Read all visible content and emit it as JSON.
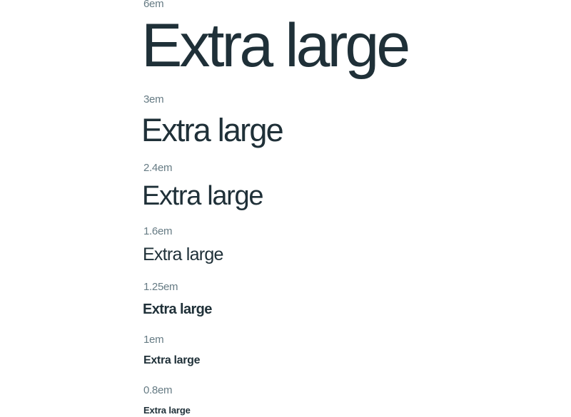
{
  "scale": [
    {
      "size_label": "6em",
      "sample_text": "Extra large"
    },
    {
      "size_label": "3em",
      "sample_text": "Extra large"
    },
    {
      "size_label": "2.4em",
      "sample_text": "Extra large"
    },
    {
      "size_label": "1.6em",
      "sample_text": "Extra large"
    },
    {
      "size_label": "1.25em",
      "sample_text": "Extra large"
    },
    {
      "size_label": "1em",
      "sample_text": "Extra large"
    },
    {
      "size_label": "0.8em",
      "sample_text": "Extra large"
    }
  ],
  "colors": {
    "label": "#667b84",
    "sample": "#1f3038",
    "background": "#ffffff"
  }
}
